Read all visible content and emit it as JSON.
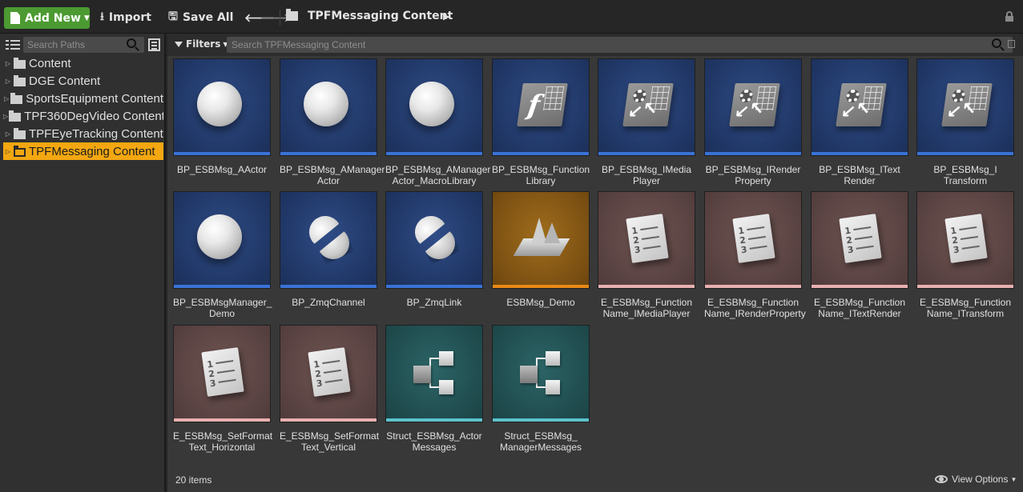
{
  "toolbar": {
    "add_new": "Add New",
    "import": "Import",
    "save_all": "Save All",
    "breadcrumb": "TPFMessaging Content"
  },
  "sidebar": {
    "search_placeholder": "Search Paths",
    "items": [
      {
        "label": "Content"
      },
      {
        "label": "DGE Content"
      },
      {
        "label": "SportsEquipment Content"
      },
      {
        "label": "TPF360DegVideo Content"
      },
      {
        "label": "TPFEyeTracking Content"
      },
      {
        "label": "TPFMessaging Content",
        "selected": true
      }
    ]
  },
  "content": {
    "filters_label": "Filters",
    "search_placeholder": "Search TPFMessaging Content",
    "status": "20 items",
    "view_options": "View Options",
    "assets": [
      {
        "name": "BP_ESBMsg_AActor",
        "icon": "sphere-icon",
        "theme": "blue"
      },
      {
        "name": "BP_ESBMsg_AManager\nActor",
        "icon": "sphere-icon",
        "theme": "blue"
      },
      {
        "name": "BP_ESBMsg_AManager\nActor_MacroLibrary",
        "icon": "sphere-icon",
        "theme": "blue"
      },
      {
        "name": "BP_ESBMsg_Function\nLibrary",
        "icon": "function-library-icon",
        "theme": "blue"
      },
      {
        "name": "BP_ESBMsg_IMedia\nPlayer",
        "icon": "interface-icon",
        "theme": "blue"
      },
      {
        "name": "BP_ESBMsg_IRender\nProperty",
        "icon": "interface-icon",
        "theme": "blue"
      },
      {
        "name": "BP_ESBMsg_IText\nRender",
        "icon": "interface-icon",
        "theme": "blue"
      },
      {
        "name": "BP_ESBMsg_I\nTransform",
        "icon": "interface-icon",
        "theme": "blue"
      },
      {
        "name": "BP_ESBMsgManager_\nDemo",
        "icon": "sphere-icon",
        "theme": "blue"
      },
      {
        "name": "BP_ZmqChannel",
        "icon": "split-sphere-icon",
        "theme": "blue"
      },
      {
        "name": "BP_ZmqLink",
        "icon": "split-sphere-icon",
        "theme": "blue"
      },
      {
        "name": "ESBMsg_Demo",
        "icon": "level-icon",
        "theme": "gold"
      },
      {
        "name": "E_ESBMsg_Function\nName_IMediaPlayer",
        "icon": "enum-icon",
        "theme": "mauve"
      },
      {
        "name": "E_ESBMsg_Function\nName_IRenderProperty",
        "icon": "enum-icon",
        "theme": "mauve"
      },
      {
        "name": "E_ESBMsg_Function\nName_ITextRender",
        "icon": "enum-icon",
        "theme": "mauve"
      },
      {
        "name": "E_ESBMsg_Function\nName_ITransform",
        "icon": "enum-icon",
        "theme": "mauve"
      },
      {
        "name": "E_ESBMsg_SetFormat\nText_Horizontal",
        "icon": "enum-icon",
        "theme": "mauve"
      },
      {
        "name": "E_ESBMsg_SetFormat\nText_Vertical",
        "icon": "enum-icon",
        "theme": "mauve"
      },
      {
        "name": "Struct_ESBMsg_Actor\nMessages",
        "icon": "struct-icon",
        "theme": "teal"
      },
      {
        "name": "Struct_ESBMsg_\nManagerMessages",
        "icon": "struct-icon",
        "theme": "teal"
      }
    ]
  },
  "colors": {
    "add_button": "#4c9a32",
    "selection": "#f3a711",
    "blueprint_bar": "#3a73d6",
    "level_bar": "#e88a17",
    "enum_bar": "#e8b0b0",
    "struct_bar": "#5cc2cc"
  }
}
